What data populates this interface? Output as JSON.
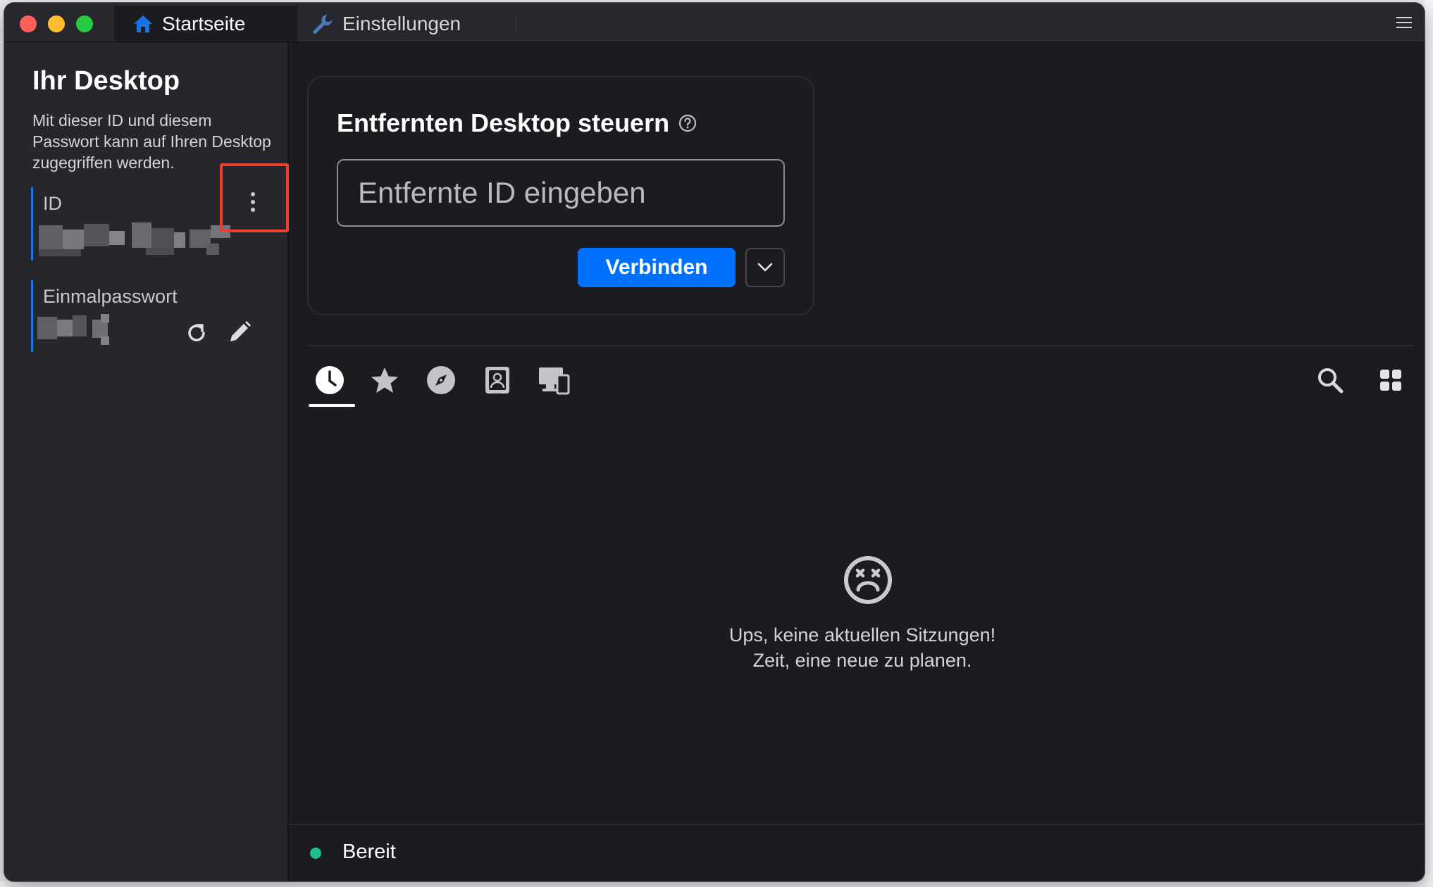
{
  "tabs": [
    {
      "label": "Startseite",
      "icon": "home-icon",
      "active": true
    },
    {
      "label": "Einstellungen",
      "icon": "wrench-icon",
      "active": false
    }
  ],
  "sidebar": {
    "title": "Ihr Desktop",
    "description": "Mit dieser ID und diesem Passwort kann auf Ihren Desktop zugegriffen werden.",
    "id_label": "ID",
    "password_label": "Einmalpasswort"
  },
  "connect": {
    "title": "Entfernten Desktop steuern",
    "input_placeholder": "Entfernte ID eingeben",
    "input_value": "",
    "connect_label": "Verbinden"
  },
  "session_tabs": [
    "clock-icon",
    "star-icon",
    "compass-icon",
    "address-book-icon",
    "devices-icon"
  ],
  "empty_state": {
    "line1": "Ups, keine aktuellen Sitzungen!",
    "line2": "Zeit, eine neue zu planen."
  },
  "status": {
    "text": "Bereit",
    "color": "#1fbf8f"
  },
  "colors": {
    "accent": "#0071ff",
    "highlight": "#e8412c"
  }
}
